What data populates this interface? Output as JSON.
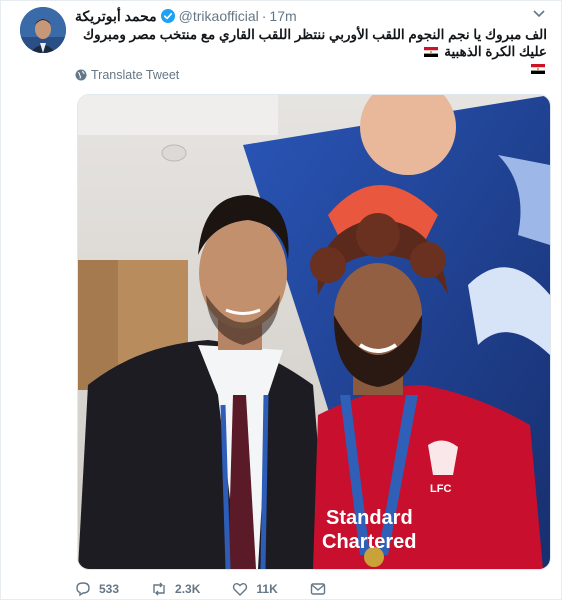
{
  "tweet": {
    "display_name": "محمد أبوتريكة",
    "handle": "@trikaofficial",
    "separator": "·",
    "time": "17m",
    "text_line1": "الف مبروك يا نجم النجوم اللقب الأوربي ننتظر اللقب القاري مع منتخب مصر ومبروك عليك الكرة الذهبية",
    "translate_label": "Translate Tweet",
    "icons": [
      "verified-badge-icon",
      "caret-down-icon",
      "globe-icon",
      "egypt-flag-icon",
      "reply-icon",
      "retweet-icon",
      "like-icon",
      "message-icon"
    ]
  },
  "photo": {
    "jersey_sponsor_line1": "Standard",
    "jersey_sponsor_line2": "Chartered",
    "club_badge": "LFC"
  },
  "actions": {
    "replies": "533",
    "retweets": "2.3K",
    "likes": "11K"
  },
  "colors": {
    "name": "#14171a",
    "secondary": "#657786",
    "verified": "#1da1f2",
    "jersey_red": "#c8102e",
    "stage_blue": "#1f3f8f"
  }
}
